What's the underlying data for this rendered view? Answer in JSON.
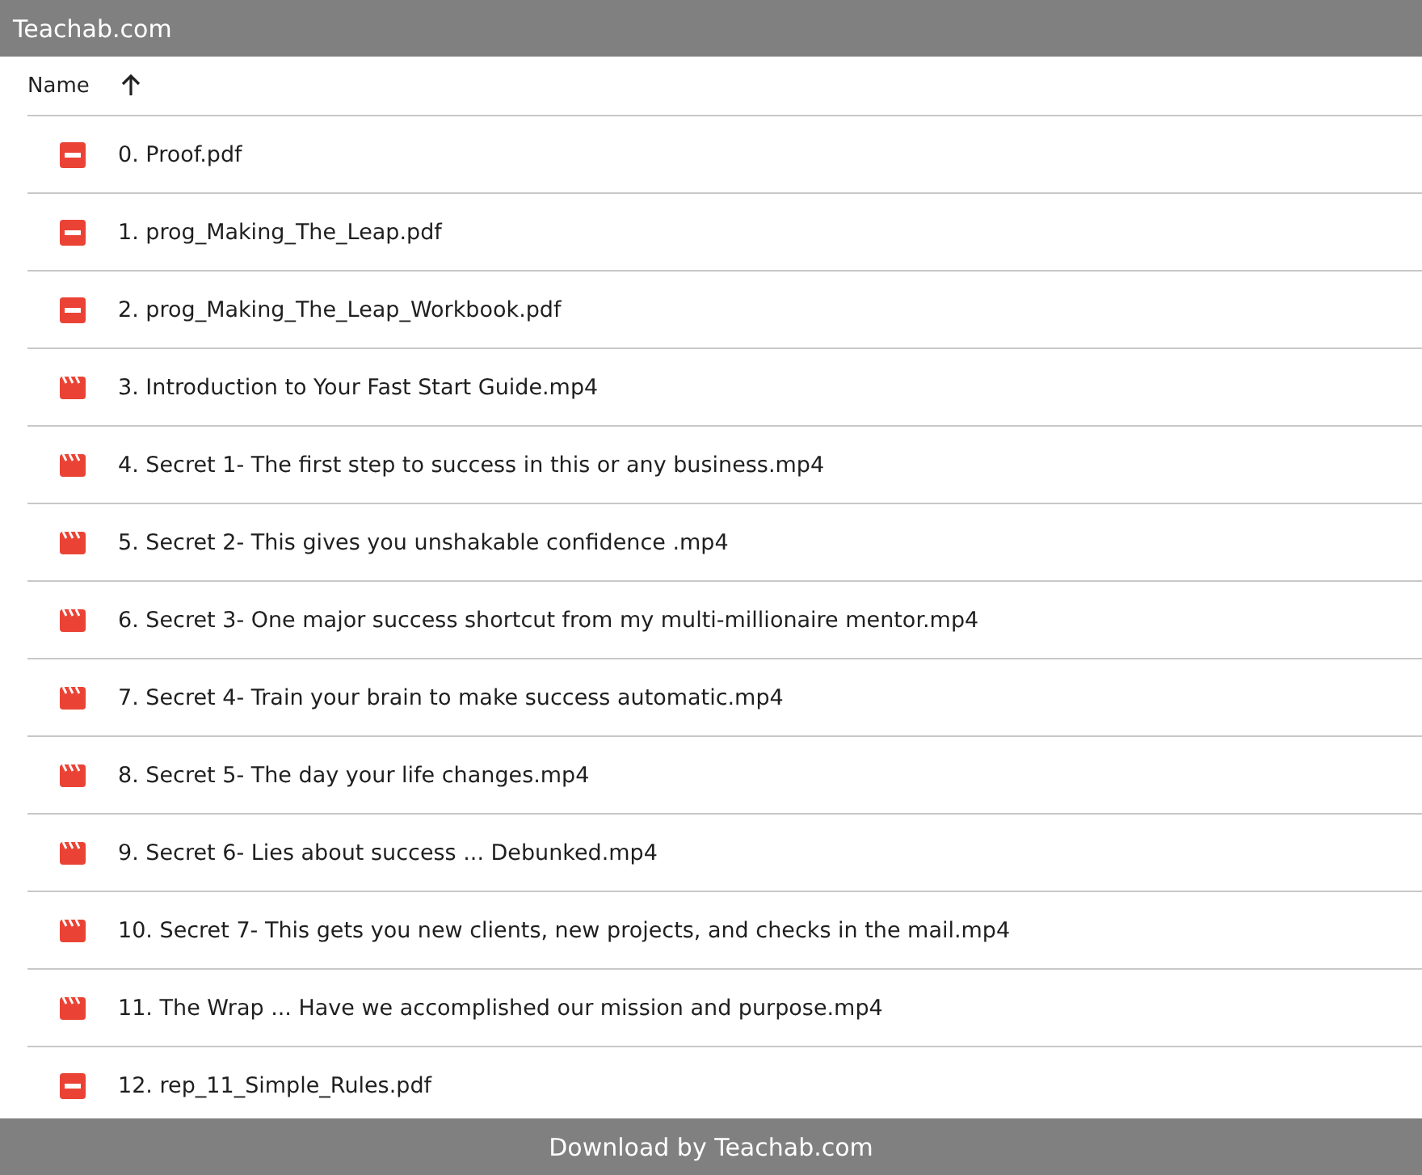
{
  "header": {
    "title": "Teachab.com"
  },
  "table": {
    "columns": [
      {
        "label": "Name",
        "sort_ascending": true
      }
    ],
    "rows": [
      {
        "kind": "pdf",
        "name": "0. Proof.pdf"
      },
      {
        "kind": "pdf",
        "name": "1. prog_Making_The_Leap.pdf"
      },
      {
        "kind": "pdf",
        "name": "2. prog_Making_The_Leap_Workbook.pdf"
      },
      {
        "kind": "video",
        "name": "3. Introduction to Your Fast Start Guide.mp4"
      },
      {
        "kind": "video",
        "name": "4. Secret 1- The first step to success in this or any business.mp4"
      },
      {
        "kind": "video",
        "name": "5. Secret 2- This gives you unshakable confidence .mp4"
      },
      {
        "kind": "video",
        "name": "6. Secret 3- One major success shortcut from my multi-millionaire mentor.mp4"
      },
      {
        "kind": "video",
        "name": "7. Secret 4- Train your brain to make success automatic.mp4"
      },
      {
        "kind": "video",
        "name": "8. Secret 5- The day your life changes.mp4"
      },
      {
        "kind": "video",
        "name": "9. Secret 6- Lies about success ... Debunked.mp4"
      },
      {
        "kind": "video",
        "name": "10. Secret 7- This gets you new clients, new projects, and checks in the mail.mp4"
      },
      {
        "kind": "video",
        "name": "11. The Wrap ... Have we accomplished our mission and purpose.mp4"
      },
      {
        "kind": "pdf",
        "name": "12. rep_11_Simple_Rules.pdf"
      }
    ]
  },
  "footer": {
    "text": "Download by Teachab.com"
  }
}
